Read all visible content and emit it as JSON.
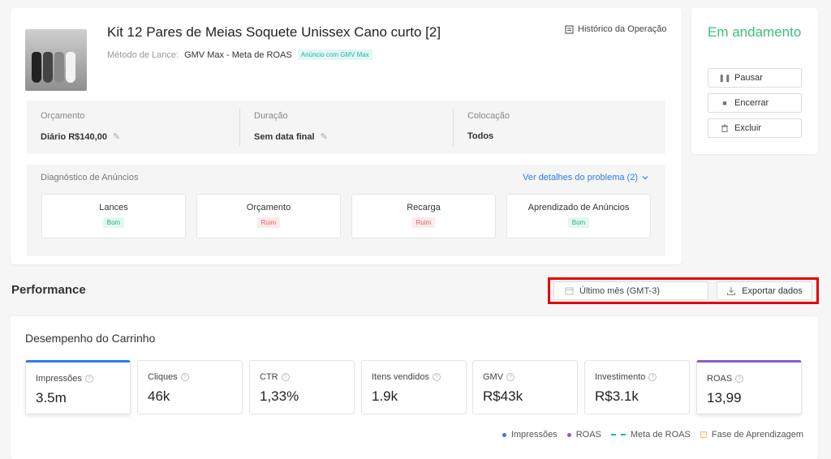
{
  "product": {
    "title": "Kit 12 Pares de Meias Soquete Unissex Cano curto [2]",
    "bid_label": "Método de Lance:",
    "bid_value": "GMV Max - Meta de ROAS",
    "bid_badge": "Anúncio com GMV Max",
    "history_link": "Histórico da Operação"
  },
  "info": {
    "budget_label": "Orçamento",
    "budget_value": "Diário R$140,00",
    "duration_label": "Duração",
    "duration_value": "Sem data final",
    "placement_label": "Colocação",
    "placement_value": "Todos"
  },
  "diagnostics": {
    "title": "Diagnóstico de Anúncios",
    "details_link": "Ver detalhes do problema (2)",
    "items": [
      {
        "name": "Lances",
        "status": "Bom",
        "status_color": "#28b27a"
      },
      {
        "name": "Orçamento",
        "status": "Ruim",
        "status_color": "#e06464"
      },
      {
        "name": "Recarga",
        "status": "Ruim",
        "status_color": "#e06464"
      },
      {
        "name": "Aprendizado de Anúncios",
        "status": "Bom",
        "status_color": "#28b27a"
      }
    ]
  },
  "status_panel": {
    "status": "Em andamento",
    "status_color": "#3cbf73",
    "pause_label": "Pausar",
    "end_label": "Encerrar",
    "delete_label": "Excluir"
  },
  "performance": {
    "title": "Performance",
    "date_range": "Último mês (GMT-3)",
    "export_label": "Exportar dados"
  },
  "cart": {
    "title": "Desempenho do Carrinho",
    "metrics": [
      {
        "label": "Impressões",
        "value": "3.5m"
      },
      {
        "label": "Cliques",
        "value": "46k"
      },
      {
        "label": "CTR",
        "value": "1,33%"
      },
      {
        "label": "Itens vendidos",
        "value": "1.9k"
      },
      {
        "label": "GMV",
        "value": "R$43k"
      },
      {
        "label": "Investimento",
        "value": "R$3.1k"
      },
      {
        "label": "ROAS",
        "value": "13,99"
      }
    ],
    "legend": {
      "impressions": "Impressões",
      "roas": "ROAS",
      "roas_target": "Meta de ROAS",
      "learning": "Fase de Aprendizagem"
    }
  },
  "colors": {
    "accent_blue": "#2f7be5",
    "accent_purple": "#8a5cc8",
    "highlight_red": "#e60000"
  }
}
